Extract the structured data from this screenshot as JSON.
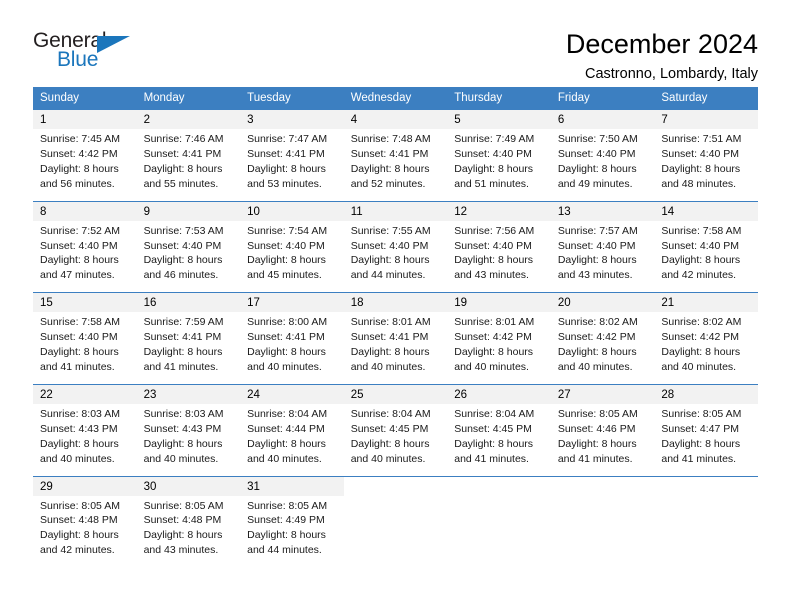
{
  "brand": {
    "name_part1": "General",
    "name_part2": "Blue",
    "triangle_color": "#1b76bc",
    "text_color": "#231f20"
  },
  "header": {
    "title": "December 2024",
    "subtitle": "Castronno, Lombardy, Italy"
  },
  "theme": {
    "header_row_bg": "#3c7fc1",
    "header_row_text": "#ffffff",
    "daynum_bg": "#f2f2f2",
    "cell_bg": "#ffffff",
    "divider": "#3c7fc1"
  },
  "calendar": {
    "weekday_headers": [
      "Sunday",
      "Monday",
      "Tuesday",
      "Wednesday",
      "Thursday",
      "Friday",
      "Saturday"
    ],
    "labels": {
      "sunrise": "Sunrise:",
      "sunset": "Sunset:",
      "daylight": "Daylight:"
    },
    "weeks": [
      [
        {
          "day": "1",
          "sunrise": "Sunrise: 7:45 AM",
          "sunset": "Sunset: 4:42 PM",
          "daylight_line1": "Daylight: 8 hours",
          "daylight_line2": "and 56 minutes."
        },
        {
          "day": "2",
          "sunrise": "Sunrise: 7:46 AM",
          "sunset": "Sunset: 4:41 PM",
          "daylight_line1": "Daylight: 8 hours",
          "daylight_line2": "and 55 minutes."
        },
        {
          "day": "3",
          "sunrise": "Sunrise: 7:47 AM",
          "sunset": "Sunset: 4:41 PM",
          "daylight_line1": "Daylight: 8 hours",
          "daylight_line2": "and 53 minutes."
        },
        {
          "day": "4",
          "sunrise": "Sunrise: 7:48 AM",
          "sunset": "Sunset: 4:41 PM",
          "daylight_line1": "Daylight: 8 hours",
          "daylight_line2": "and 52 minutes."
        },
        {
          "day": "5",
          "sunrise": "Sunrise: 7:49 AM",
          "sunset": "Sunset: 4:40 PM",
          "daylight_line1": "Daylight: 8 hours",
          "daylight_line2": "and 51 minutes."
        },
        {
          "day": "6",
          "sunrise": "Sunrise: 7:50 AM",
          "sunset": "Sunset: 4:40 PM",
          "daylight_line1": "Daylight: 8 hours",
          "daylight_line2": "and 49 minutes."
        },
        {
          "day": "7",
          "sunrise": "Sunrise: 7:51 AM",
          "sunset": "Sunset: 4:40 PM",
          "daylight_line1": "Daylight: 8 hours",
          "daylight_line2": "and 48 minutes."
        }
      ],
      [
        {
          "day": "8",
          "sunrise": "Sunrise: 7:52 AM",
          "sunset": "Sunset: 4:40 PM",
          "daylight_line1": "Daylight: 8 hours",
          "daylight_line2": "and 47 minutes."
        },
        {
          "day": "9",
          "sunrise": "Sunrise: 7:53 AM",
          "sunset": "Sunset: 4:40 PM",
          "daylight_line1": "Daylight: 8 hours",
          "daylight_line2": "and 46 minutes."
        },
        {
          "day": "10",
          "sunrise": "Sunrise: 7:54 AM",
          "sunset": "Sunset: 4:40 PM",
          "daylight_line1": "Daylight: 8 hours",
          "daylight_line2": "and 45 minutes."
        },
        {
          "day": "11",
          "sunrise": "Sunrise: 7:55 AM",
          "sunset": "Sunset: 4:40 PM",
          "daylight_line1": "Daylight: 8 hours",
          "daylight_line2": "and 44 minutes."
        },
        {
          "day": "12",
          "sunrise": "Sunrise: 7:56 AM",
          "sunset": "Sunset: 4:40 PM",
          "daylight_line1": "Daylight: 8 hours",
          "daylight_line2": "and 43 minutes."
        },
        {
          "day": "13",
          "sunrise": "Sunrise: 7:57 AM",
          "sunset": "Sunset: 4:40 PM",
          "daylight_line1": "Daylight: 8 hours",
          "daylight_line2": "and 43 minutes."
        },
        {
          "day": "14",
          "sunrise": "Sunrise: 7:58 AM",
          "sunset": "Sunset: 4:40 PM",
          "daylight_line1": "Daylight: 8 hours",
          "daylight_line2": "and 42 minutes."
        }
      ],
      [
        {
          "day": "15",
          "sunrise": "Sunrise: 7:58 AM",
          "sunset": "Sunset: 4:40 PM",
          "daylight_line1": "Daylight: 8 hours",
          "daylight_line2": "and 41 minutes."
        },
        {
          "day": "16",
          "sunrise": "Sunrise: 7:59 AM",
          "sunset": "Sunset: 4:41 PM",
          "daylight_line1": "Daylight: 8 hours",
          "daylight_line2": "and 41 minutes."
        },
        {
          "day": "17",
          "sunrise": "Sunrise: 8:00 AM",
          "sunset": "Sunset: 4:41 PM",
          "daylight_line1": "Daylight: 8 hours",
          "daylight_line2": "and 40 minutes."
        },
        {
          "day": "18",
          "sunrise": "Sunrise: 8:01 AM",
          "sunset": "Sunset: 4:41 PM",
          "daylight_line1": "Daylight: 8 hours",
          "daylight_line2": "and 40 minutes."
        },
        {
          "day": "19",
          "sunrise": "Sunrise: 8:01 AM",
          "sunset": "Sunset: 4:42 PM",
          "daylight_line1": "Daylight: 8 hours",
          "daylight_line2": "and 40 minutes."
        },
        {
          "day": "20",
          "sunrise": "Sunrise: 8:02 AM",
          "sunset": "Sunset: 4:42 PM",
          "daylight_line1": "Daylight: 8 hours",
          "daylight_line2": "and 40 minutes."
        },
        {
          "day": "21",
          "sunrise": "Sunrise: 8:02 AM",
          "sunset": "Sunset: 4:42 PM",
          "daylight_line1": "Daylight: 8 hours",
          "daylight_line2": "and 40 minutes."
        }
      ],
      [
        {
          "day": "22",
          "sunrise": "Sunrise: 8:03 AM",
          "sunset": "Sunset: 4:43 PM",
          "daylight_line1": "Daylight: 8 hours",
          "daylight_line2": "and 40 minutes."
        },
        {
          "day": "23",
          "sunrise": "Sunrise: 8:03 AM",
          "sunset": "Sunset: 4:43 PM",
          "daylight_line1": "Daylight: 8 hours",
          "daylight_line2": "and 40 minutes."
        },
        {
          "day": "24",
          "sunrise": "Sunrise: 8:04 AM",
          "sunset": "Sunset: 4:44 PM",
          "daylight_line1": "Daylight: 8 hours",
          "daylight_line2": "and 40 minutes."
        },
        {
          "day": "25",
          "sunrise": "Sunrise: 8:04 AM",
          "sunset": "Sunset: 4:45 PM",
          "daylight_line1": "Daylight: 8 hours",
          "daylight_line2": "and 40 minutes."
        },
        {
          "day": "26",
          "sunrise": "Sunrise: 8:04 AM",
          "sunset": "Sunset: 4:45 PM",
          "daylight_line1": "Daylight: 8 hours",
          "daylight_line2": "and 41 minutes."
        },
        {
          "day": "27",
          "sunrise": "Sunrise: 8:05 AM",
          "sunset": "Sunset: 4:46 PM",
          "daylight_line1": "Daylight: 8 hours",
          "daylight_line2": "and 41 minutes."
        },
        {
          "day": "28",
          "sunrise": "Sunrise: 8:05 AM",
          "sunset": "Sunset: 4:47 PM",
          "daylight_line1": "Daylight: 8 hours",
          "daylight_line2": "and 41 minutes."
        }
      ],
      [
        {
          "day": "29",
          "sunrise": "Sunrise: 8:05 AM",
          "sunset": "Sunset: 4:48 PM",
          "daylight_line1": "Daylight: 8 hours",
          "daylight_line2": "and 42 minutes."
        },
        {
          "day": "30",
          "sunrise": "Sunrise: 8:05 AM",
          "sunset": "Sunset: 4:48 PM",
          "daylight_line1": "Daylight: 8 hours",
          "daylight_line2": "and 43 minutes."
        },
        {
          "day": "31",
          "sunrise": "Sunrise: 8:05 AM",
          "sunset": "Sunset: 4:49 PM",
          "daylight_line1": "Daylight: 8 hours",
          "daylight_line2": "and 44 minutes."
        },
        {
          "day": "",
          "sunrise": "",
          "sunset": "",
          "daylight_line1": "",
          "daylight_line2": ""
        },
        {
          "day": "",
          "sunrise": "",
          "sunset": "",
          "daylight_line1": "",
          "daylight_line2": ""
        },
        {
          "day": "",
          "sunrise": "",
          "sunset": "",
          "daylight_line1": "",
          "daylight_line2": ""
        },
        {
          "day": "",
          "sunrise": "",
          "sunset": "",
          "daylight_line1": "",
          "daylight_line2": ""
        }
      ]
    ]
  }
}
